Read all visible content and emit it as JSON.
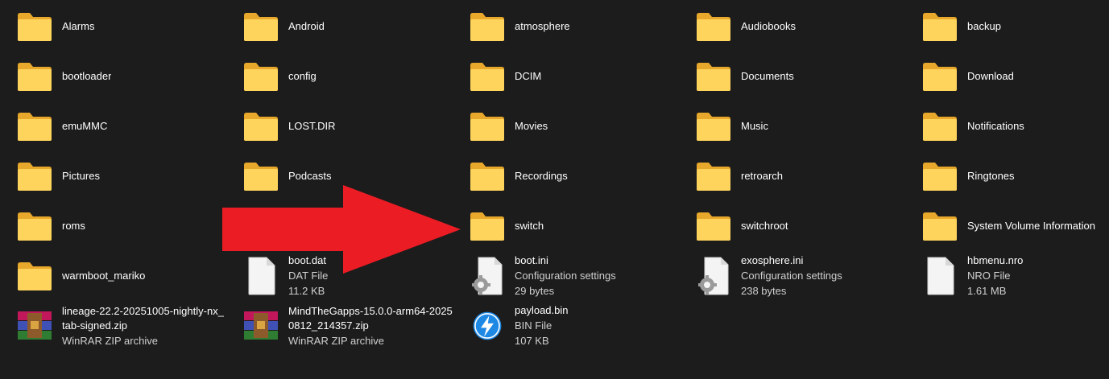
{
  "items": [
    {
      "name": "Alarms",
      "type": "folder"
    },
    {
      "name": "Android",
      "type": "folder"
    },
    {
      "name": "atmosphere",
      "type": "folder"
    },
    {
      "name": "Audiobooks",
      "type": "folder"
    },
    {
      "name": "backup",
      "type": "folder"
    },
    {
      "name": "bootloader",
      "type": "folder"
    },
    {
      "name": "config",
      "type": "folder"
    },
    {
      "name": "DCIM",
      "type": "folder"
    },
    {
      "name": "Documents",
      "type": "folder"
    },
    {
      "name": "Download",
      "type": "folder"
    },
    {
      "name": "emuMMC",
      "type": "folder"
    },
    {
      "name": "LOST.DIR",
      "type": "folder"
    },
    {
      "name": "Movies",
      "type": "folder"
    },
    {
      "name": "Music",
      "type": "folder"
    },
    {
      "name": "Notifications",
      "type": "folder"
    },
    {
      "name": "Pictures",
      "type": "folder"
    },
    {
      "name": "Podcasts",
      "type": "folder"
    },
    {
      "name": "Recordings",
      "type": "folder"
    },
    {
      "name": "retroarch",
      "type": "folder"
    },
    {
      "name": "Ringtones",
      "type": "folder"
    },
    {
      "name": "roms",
      "type": "folder"
    },
    {
      "name": "",
      "type": "hidden"
    },
    {
      "name": "switch",
      "type": "folder"
    },
    {
      "name": "switchroot",
      "type": "folder"
    },
    {
      "name": "System Volume Information",
      "type": "folder"
    },
    {
      "name": "warmboot_mariko",
      "type": "folder"
    },
    {
      "name": "boot.dat",
      "type": "file",
      "kind": "DAT File",
      "size": "11.2 KB"
    },
    {
      "name": "boot.ini",
      "type": "config",
      "kind": "Configuration settings",
      "size": "29 bytes"
    },
    {
      "name": "exosphere.ini",
      "type": "config",
      "kind": "Configuration settings",
      "size": "238 bytes"
    },
    {
      "name": "hbmenu.nro",
      "type": "file",
      "kind": "NRO File",
      "size": "1.61 MB"
    },
    {
      "name": "lineage-22.2-20251005-nightly-nx_",
      "name2": "tab-signed.zip",
      "type": "zip",
      "kind": "WinRAR ZIP archive"
    },
    {
      "name": "MindTheGapps-15.0.0-arm64-2025",
      "name2": "0812_214357.zip",
      "type": "zip",
      "kind": "WinRAR ZIP archive"
    },
    {
      "name": "payload.bin",
      "type": "bin",
      "kind": "BIN File",
      "size": "107 KB"
    }
  ],
  "colors": {
    "background": "#1c1c1c",
    "folder_back": "#e8a82c",
    "folder_front": "#ffd45c",
    "arrow": "#ec1c24"
  },
  "annotation": {
    "shape": "arrow-right",
    "color": "#ec1c24",
    "points_to": "switch"
  }
}
